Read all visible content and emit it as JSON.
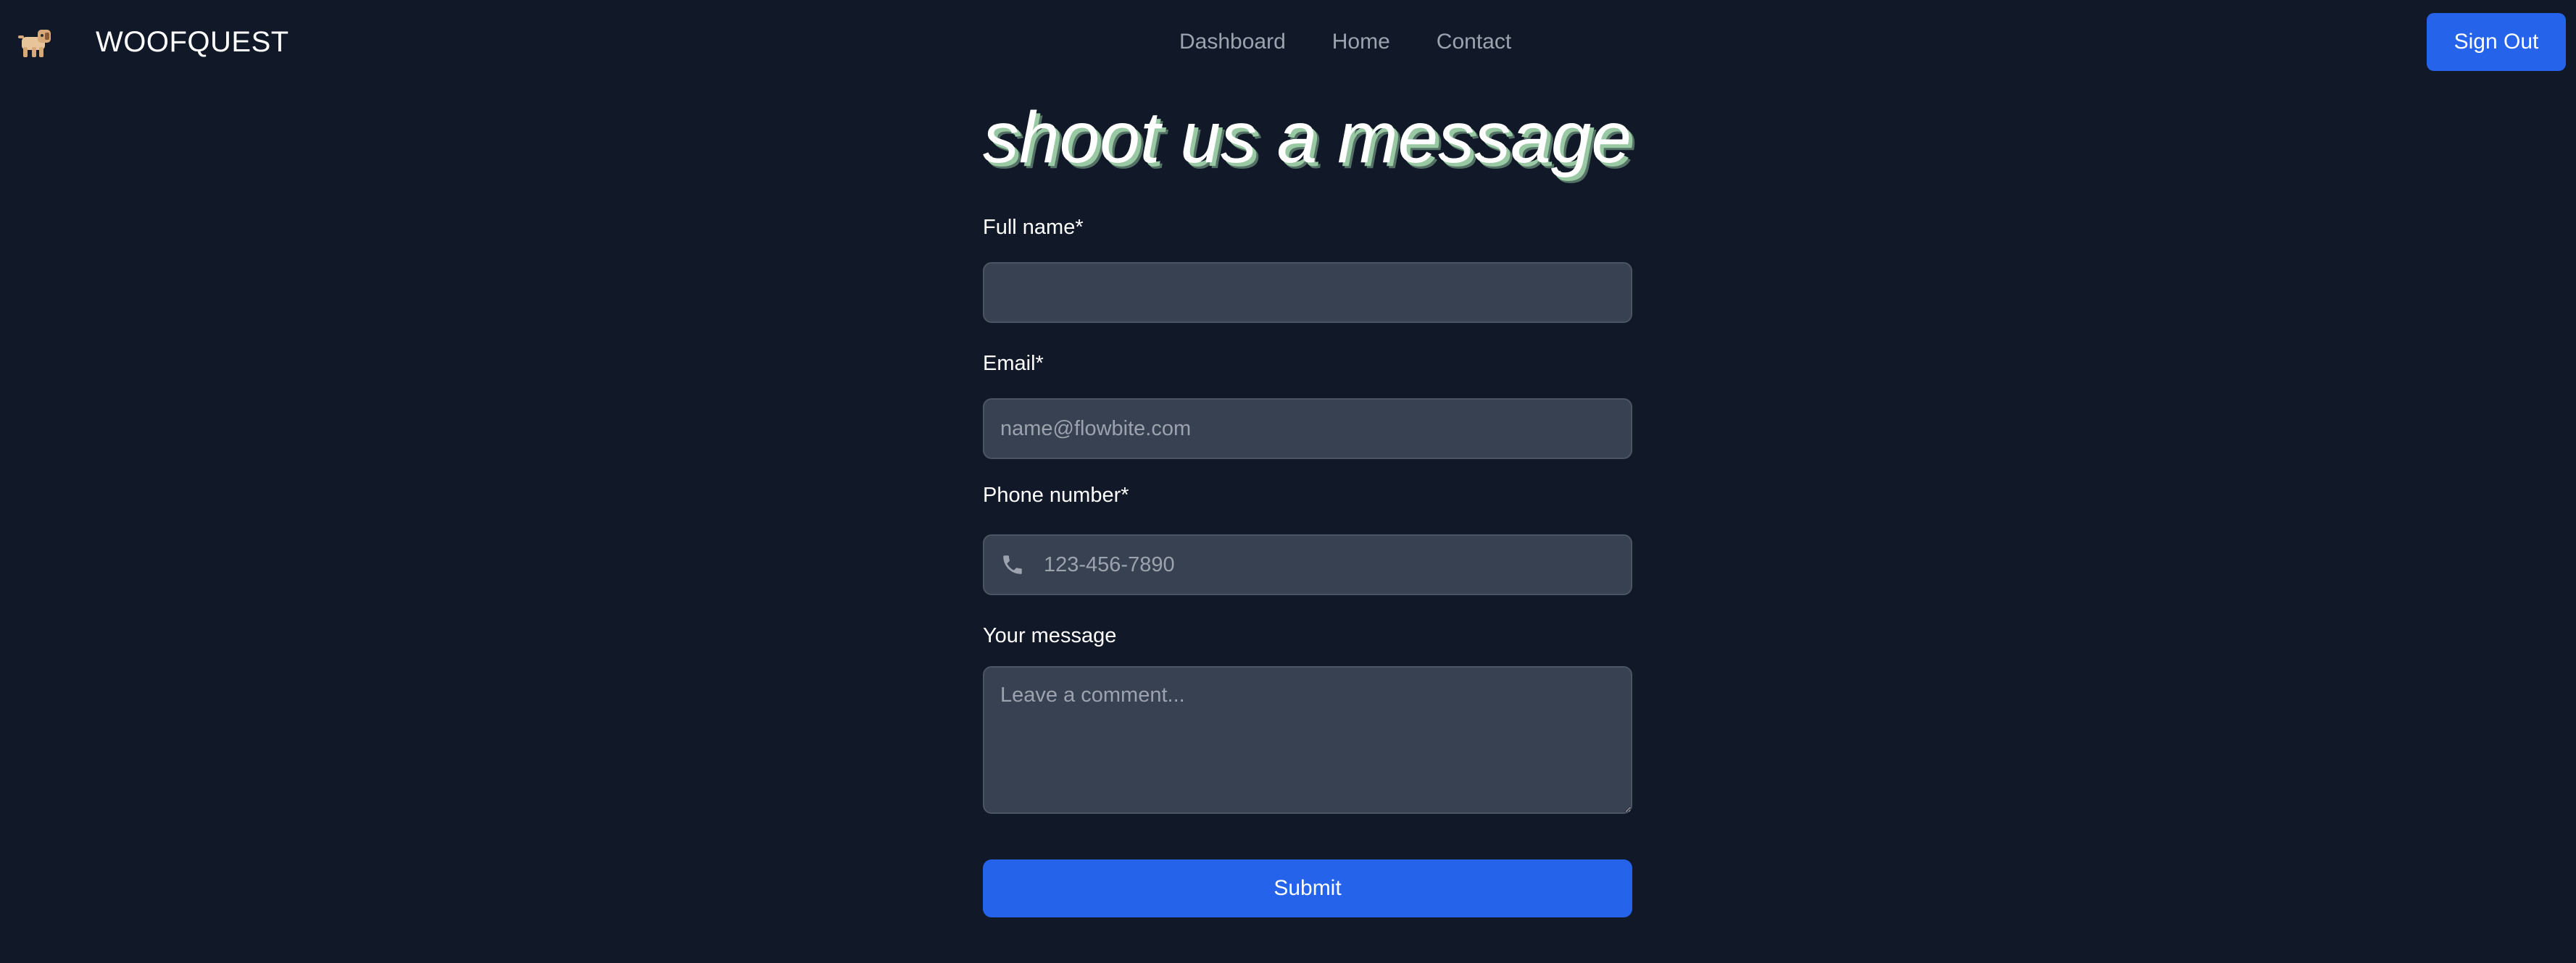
{
  "header": {
    "brand_name": "WOOFQUEST",
    "logo_icon": "dog-icon",
    "nav": [
      {
        "label": "Dashboard"
      },
      {
        "label": "Home"
      },
      {
        "label": "Contact"
      }
    ],
    "sign_out_label": "Sign Out"
  },
  "form": {
    "title": "shoot us a message",
    "full_name": {
      "label": "Full name*",
      "value": "",
      "placeholder": ""
    },
    "email": {
      "label": "Email*",
      "value": "",
      "placeholder": "name@flowbite.com"
    },
    "phone": {
      "label": "Phone number*",
      "value": "",
      "placeholder": "123-456-7890",
      "icon": "phone-icon"
    },
    "message": {
      "label": "Your message",
      "value": "",
      "placeholder": "Leave a comment..."
    },
    "submit_label": "Submit"
  },
  "colors": {
    "background": "#111827",
    "accent": "#2563eb",
    "input_bg": "#374151",
    "title_shadow": "#98c9a3"
  }
}
